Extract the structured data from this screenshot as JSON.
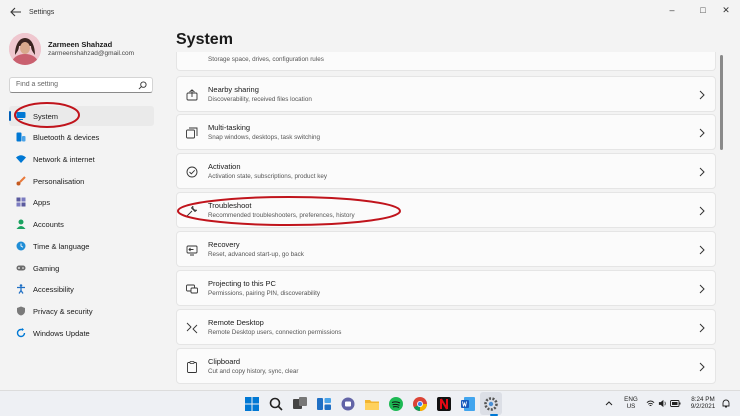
{
  "window": {
    "title": "Settings",
    "controls": {
      "minimize": "–",
      "maximize": "□",
      "close": "✕"
    }
  },
  "profile": {
    "name": "Zarmeen Shahzad",
    "email": "zarmeenshahzad@gmail.com"
  },
  "search": {
    "placeholder": "Find a setting",
    "icon": "search-icon"
  },
  "sidebar": {
    "items": [
      {
        "label": "System",
        "icon": "monitor-icon",
        "color": "#0078d4",
        "selected": true
      },
      {
        "label": "Bluetooth & devices",
        "icon": "bluetooth-icon",
        "color": "#0078d4"
      },
      {
        "label": "Network & internet",
        "icon": "wifi-icon",
        "color": "#0078d4"
      },
      {
        "label": "Personalisation",
        "icon": "brush-icon",
        "color": "#e8793a"
      },
      {
        "label": "Apps",
        "icon": "apps-icon",
        "color": "#5a5a9e"
      },
      {
        "label": "Accounts",
        "icon": "person-icon",
        "color": "#1aa260"
      },
      {
        "label": "Time & language",
        "icon": "globe-clock-icon",
        "color": "#1f8dd6"
      },
      {
        "label": "Gaming",
        "icon": "gamepad-icon",
        "color": "#6b6b6b"
      },
      {
        "label": "Accessibility",
        "icon": "accessibility-icon",
        "color": "#1f6fc4"
      },
      {
        "label": "Privacy & security",
        "icon": "shield-icon",
        "color": "#7a7a7a"
      },
      {
        "label": "Windows Update",
        "icon": "update-icon",
        "color": "#0078d4"
      }
    ]
  },
  "main": {
    "title": "System",
    "partial_desc": "Storage space, drives, configuration rules",
    "cards": [
      {
        "title": "Nearby sharing",
        "desc": "Discoverability, received files location",
        "icon": "share-icon"
      },
      {
        "title": "Multi-tasking",
        "desc": "Snap windows, desktops, task switching",
        "icon": "multitask-icon"
      },
      {
        "title": "Activation",
        "desc": "Activation state, subscriptions, product key",
        "icon": "check-circle-icon"
      },
      {
        "title": "Troubleshoot",
        "desc": "Recommended troubleshooters, preferences, history",
        "icon": "wrench-icon"
      },
      {
        "title": "Recovery",
        "desc": "Reset, advanced start-up, go back",
        "icon": "recovery-icon"
      },
      {
        "title": "Projecting to this PC",
        "desc": "Permissions, pairing PIN, discoverability",
        "icon": "projector-icon"
      },
      {
        "title": "Remote Desktop",
        "desc": "Remote Desktop users, connection permissions",
        "icon": "remote-desktop-icon"
      },
      {
        "title": "Clipboard",
        "desc": "Cut and copy history, sync, clear",
        "icon": "clipboard-icon"
      }
    ]
  },
  "annotation_color": "#c0141c",
  "taskbar": {
    "icons": [
      "windows-start-icon",
      "search-icon",
      "task-view-icon",
      "widgets-icon",
      "chat-icon",
      "file-explorer-icon",
      "spotify-icon",
      "chrome-icon",
      "netflix-icon",
      "word-icon",
      "settings-icon"
    ],
    "language_top": "ENG",
    "language_bottom": "US",
    "time": "8:24 PM",
    "date": "9/2/2021"
  }
}
